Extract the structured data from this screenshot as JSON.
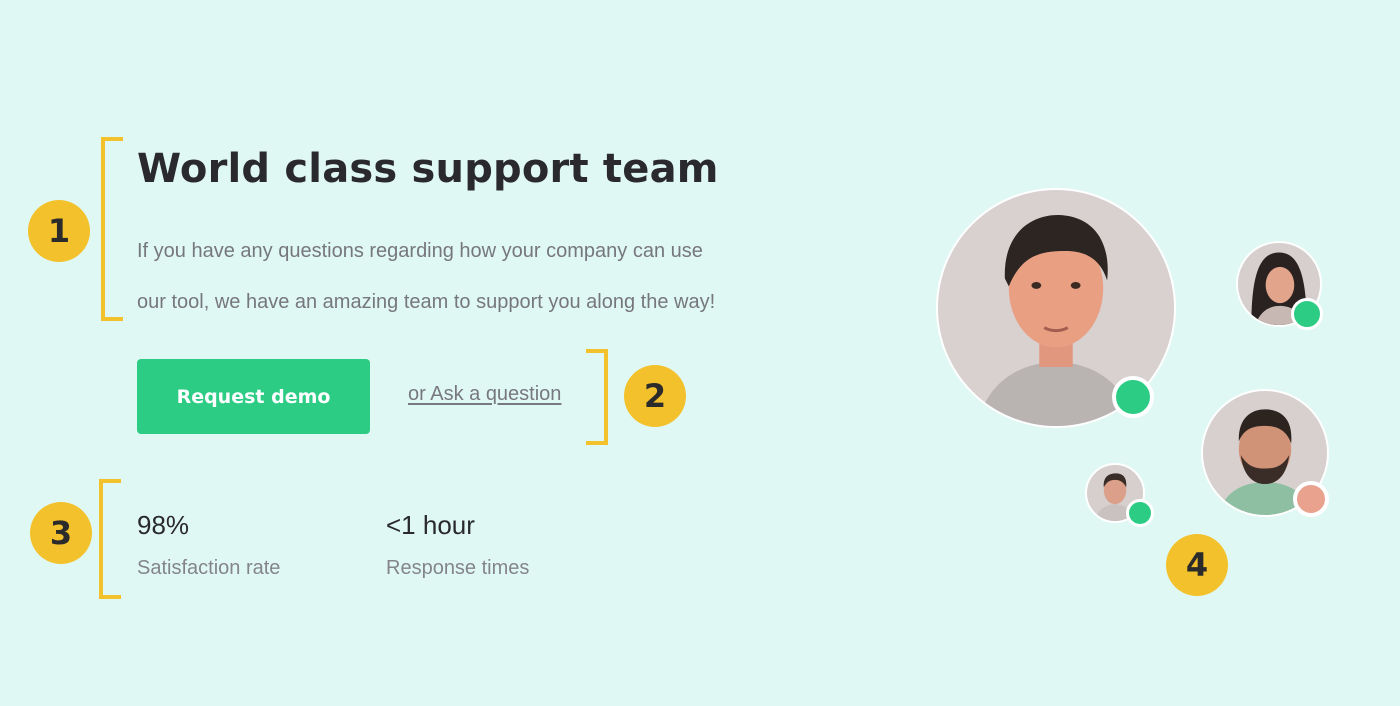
{
  "hero": {
    "title": "World class support team",
    "description_line1": "If you have any questions regarding how your company can use",
    "description_line2": "our tool, we have an amazing team to support you along the way!"
  },
  "actions": {
    "primary_label": "Request demo",
    "secondary_label": "or Ask a question"
  },
  "stats": [
    {
      "value": "98%",
      "label": "Satisfaction rate"
    },
    {
      "value": "<1 hour",
      "label": "Response times"
    }
  ],
  "annotations": [
    "1",
    "2",
    "3",
    "4"
  ],
  "team": {
    "members": [
      {
        "avatar": "man-portrait-large",
        "status": "online"
      },
      {
        "avatar": "woman-portrait",
        "status": "online"
      },
      {
        "avatar": "bearded-man-portrait",
        "status": "away"
      },
      {
        "avatar": "man-portrait-small",
        "status": "online"
      }
    ]
  },
  "colors": {
    "background": "#e0f8f3",
    "accent_green": "#2ccc85",
    "annotation_yellow": "#f3c12b",
    "status_online": "#2ccc85",
    "status_away": "#e8a28e"
  }
}
